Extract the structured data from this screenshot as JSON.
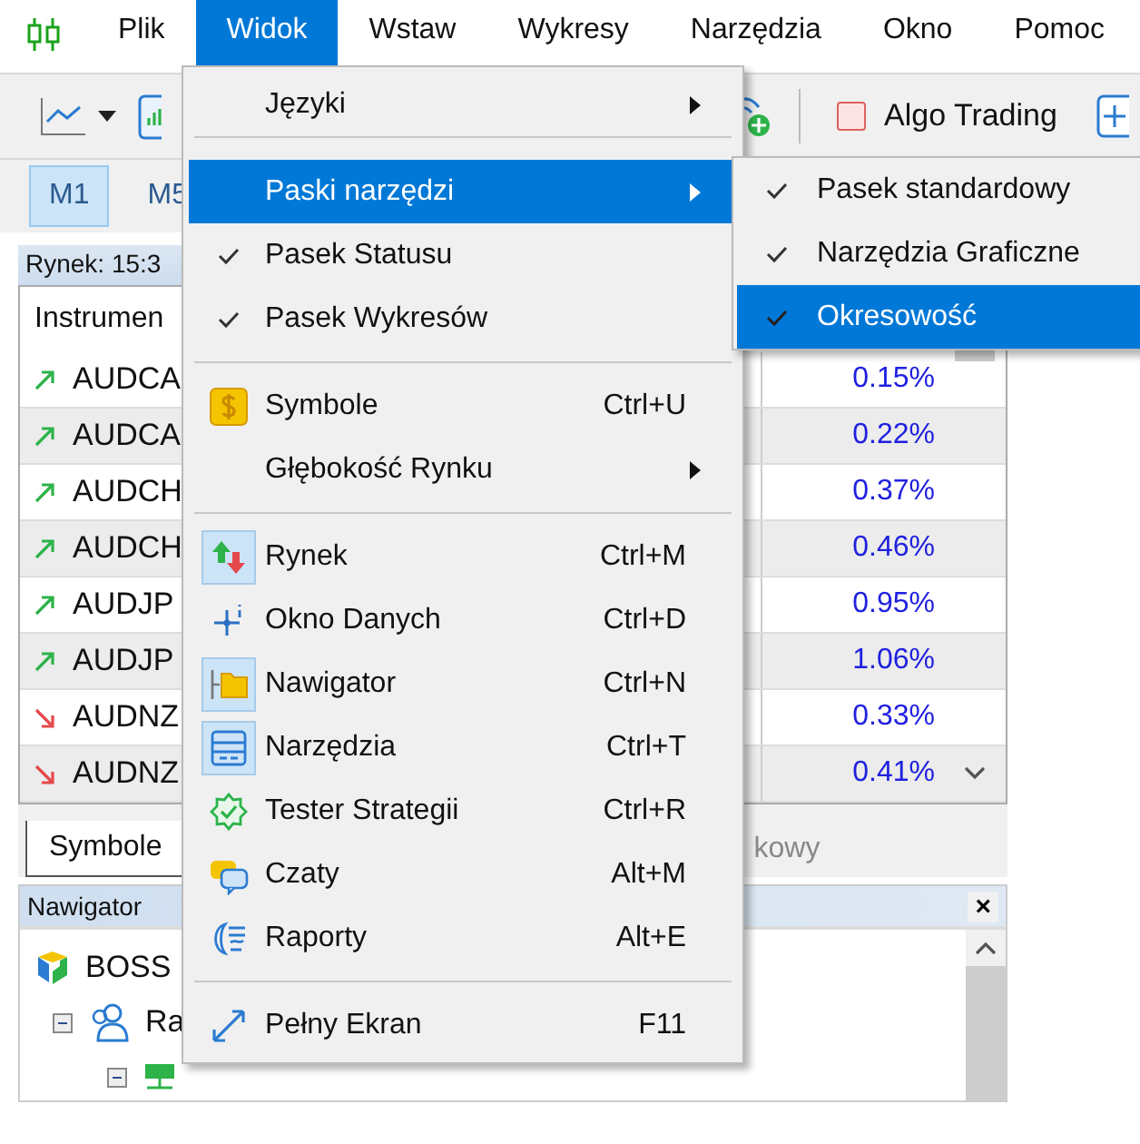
{
  "menu_bar": [
    {
      "label": "Plik",
      "selected": false
    },
    {
      "label": "Widok",
      "selected": true
    },
    {
      "label": "Wstaw",
      "selected": false
    },
    {
      "label": "Wykresy",
      "selected": false
    },
    {
      "label": "Narzędzia",
      "selected": false
    },
    {
      "label": "Okno",
      "selected": false
    },
    {
      "label": "Pomoc",
      "selected": false
    }
  ],
  "toolbar": {
    "algo_trading": {
      "label": "Algo Trading",
      "on": false
    }
  },
  "timeframes": [
    {
      "label": "M1",
      "selected": true
    },
    {
      "label": "M5",
      "selected": false
    }
  ],
  "market_watch": {
    "title": "Rynek: 15:3",
    "columns": [
      "Instrumen"
    ],
    "rows": [
      {
        "kind": "up",
        "symbol": "AUDCA",
        "column_3": "0.15%"
      },
      {
        "kind": "up",
        "symbol": "AUDCA",
        "column_3": "0.22%"
      },
      {
        "kind": "up",
        "symbol": "AUDCH",
        "column_3": "0.37%"
      },
      {
        "kind": "up",
        "symbol": "AUDCH",
        "column_3": "0.46%"
      },
      {
        "kind": "up",
        "symbol": "AUDJP",
        "column_3": "0.95%"
      },
      {
        "kind": "up",
        "symbol": "AUDJP",
        "column_3": "1.06%"
      },
      {
        "kind": "down",
        "symbol": "AUDNZ",
        "column_3": "0.33%"
      },
      {
        "kind": "down",
        "symbol": "AUDNZ",
        "column_3": "0.41%"
      }
    ],
    "tabs": [
      {
        "label": "Symbole",
        "selected": true
      },
      {
        "label": "kowy",
        "selected": false
      }
    ]
  },
  "navigator": {
    "title": "Nawigator",
    "close": "×",
    "tree": [
      {
        "label": "BOSS",
        "children": [
          {
            "label": "Ra",
            "expanded": true
          }
        ]
      }
    ]
  },
  "view_menu": [
    {
      "kind": "submenu",
      "label": "Języki",
      "selected": false
    },
    {
      "kind": "separator"
    },
    {
      "kind": "submenu",
      "label": "Paski narzędzi",
      "selected": true
    },
    {
      "kind": "check",
      "label": "Pasek Statusu",
      "checked": true,
      "selected": false
    },
    {
      "kind": "check",
      "label": "Pasek Wykresów",
      "checked": true,
      "selected": false
    },
    {
      "kind": "separator"
    },
    {
      "kind": "icon",
      "label": "Symbole",
      "shortcut": "Ctrl+U",
      "checked": false,
      "selected": false
    },
    {
      "kind": "submenu",
      "label": "Głębokość Rynku",
      "selected": false
    },
    {
      "kind": "separator"
    },
    {
      "kind": "icon",
      "label": "Rynek",
      "shortcut": "Ctrl+M",
      "checked": true,
      "selected": false
    },
    {
      "kind": "icon",
      "label": "Okno Danych",
      "shortcut": "Ctrl+D",
      "checked": false,
      "selected": false
    },
    {
      "kind": "icon",
      "label": "Nawigator",
      "shortcut": "Ctrl+N",
      "checked": true,
      "selected": false
    },
    {
      "kind": "icon",
      "label": "Narzędzia",
      "shortcut": "Ctrl+T",
      "checked": true,
      "selected": false
    },
    {
      "kind": "icon",
      "label": "Tester Strategii",
      "shortcut": "Ctrl+R",
      "checked": false,
      "selected": false
    },
    {
      "kind": "icon",
      "label": "Czaty",
      "shortcut": "Alt+M",
      "checked": false,
      "selected": false
    },
    {
      "kind": "icon",
      "label": "Raporty",
      "shortcut": "Alt+E",
      "checked": false,
      "selected": false
    },
    {
      "kind": "separator"
    },
    {
      "kind": "icon",
      "label": "Pełny Ekran",
      "shortcut": "F11",
      "checked": false,
      "selected": false
    }
  ],
  "toolbars_submenu": [
    {
      "label": "Pasek standardowy",
      "checked": true,
      "selected": false
    },
    {
      "label": "Narzędzia Graficzne",
      "checked": true,
      "selected": false
    },
    {
      "label": "Okresowość",
      "checked": true,
      "selected": true
    }
  ]
}
